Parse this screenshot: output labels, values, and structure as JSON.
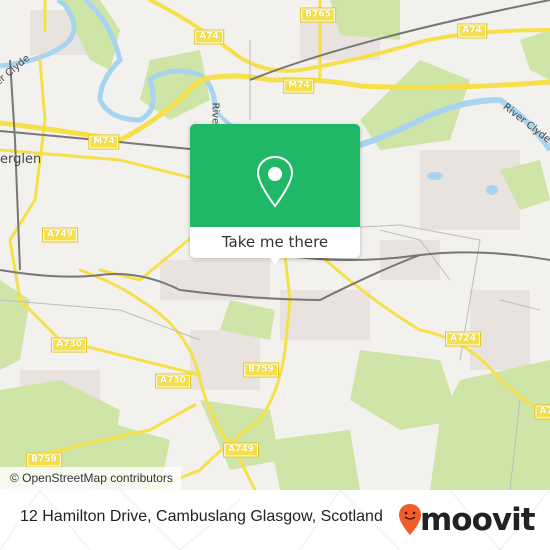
{
  "map": {
    "road_shields": [
      {
        "label": "B765",
        "id": "b765-top"
      },
      {
        "label": "A74",
        "id": "a74-left"
      },
      {
        "label": "A74",
        "id": "a74-right"
      },
      {
        "label": "M74",
        "id": "m74-left"
      },
      {
        "label": "M74",
        "id": "m74-center"
      },
      {
        "label": "A749",
        "id": "a749-left"
      },
      {
        "label": "A730",
        "id": "a730-left"
      },
      {
        "label": "A730",
        "id": "a730-center"
      },
      {
        "label": "B759",
        "id": "b759-center"
      },
      {
        "label": "A724",
        "id": "a724"
      },
      {
        "label": "A7",
        "id": "a7-edge"
      },
      {
        "label": "A749",
        "id": "a749-bottom"
      },
      {
        "label": "B759",
        "id": "b759-bottom"
      }
    ],
    "water_labels": [
      {
        "label": "River Clyde",
        "id": "clyde-right"
      },
      {
        "label": "River Clyde",
        "id": "clyde-left"
      },
      {
        "label": "River",
        "id": "river-center"
      }
    ],
    "place_labels": [
      {
        "label": "erglen",
        "id": "rutherglen"
      }
    ],
    "colors": {
      "background": "#f2f1ee",
      "park": "#cfe5a8",
      "water": "#a8d4ef",
      "road": "#f6e04a",
      "rail": "#777777",
      "popup_green": "#1eb866",
      "moovit_orange": "#f25b2a"
    }
  },
  "popup": {
    "icon": "location-pin-icon",
    "button_label": "Take me there"
  },
  "attribution": "© OpenStreetMap contributors",
  "footer": {
    "address": "12 Hamilton Drive, Cambuslang Glasgow, Scotland",
    "logo_text": "moovit",
    "logo_icon": "moovit-pin-smile-icon"
  }
}
